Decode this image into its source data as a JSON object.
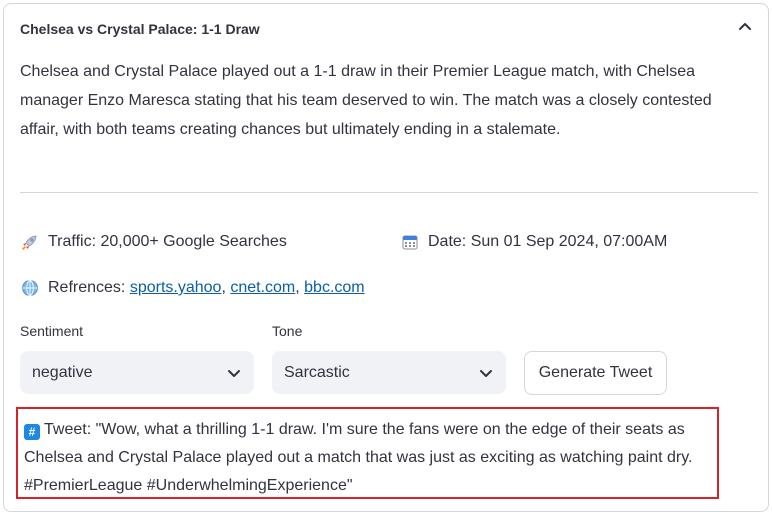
{
  "expander": {
    "title": "Chelsea vs Crystal Palace: 1-1 Draw",
    "summary": "Chelsea and Crystal Palace played out a 1-1 draw in their Premier League match, with Chelsea manager Enzo Maresca stating that his team deserved to win. The match was a closely contested affair, with both teams creating chances but ultimately ending in a stalemate."
  },
  "meta": {
    "traffic": "Traffic: 20,000+ Google Searches",
    "date": "Date: Sun 01 Sep 2024, 07:00AM",
    "references_label": "Refrences:",
    "references": [
      "sports.yahoo",
      "cnet.com",
      "bbc.com"
    ]
  },
  "controls": {
    "sentiment_label": "Sentiment",
    "sentiment_value": "negative",
    "tone_label": "Tone",
    "tone_value": "Sarcastic",
    "generate_label": "Generate Tweet"
  },
  "tweet": {
    "icon": "#",
    "text": "Tweet: \"Wow, what a thrilling 1-1 draw. I'm sure the fans were on the edge of their seats as Chelsea and Crystal Palace played out a match that was just as exciting as watching paint dry. #PremierLeague #UnderwhelmingExperience\""
  },
  "colors": {
    "tweet_border": "#d9212a",
    "link": "#0b5ea8",
    "select_bg": "#f0f2f6"
  }
}
